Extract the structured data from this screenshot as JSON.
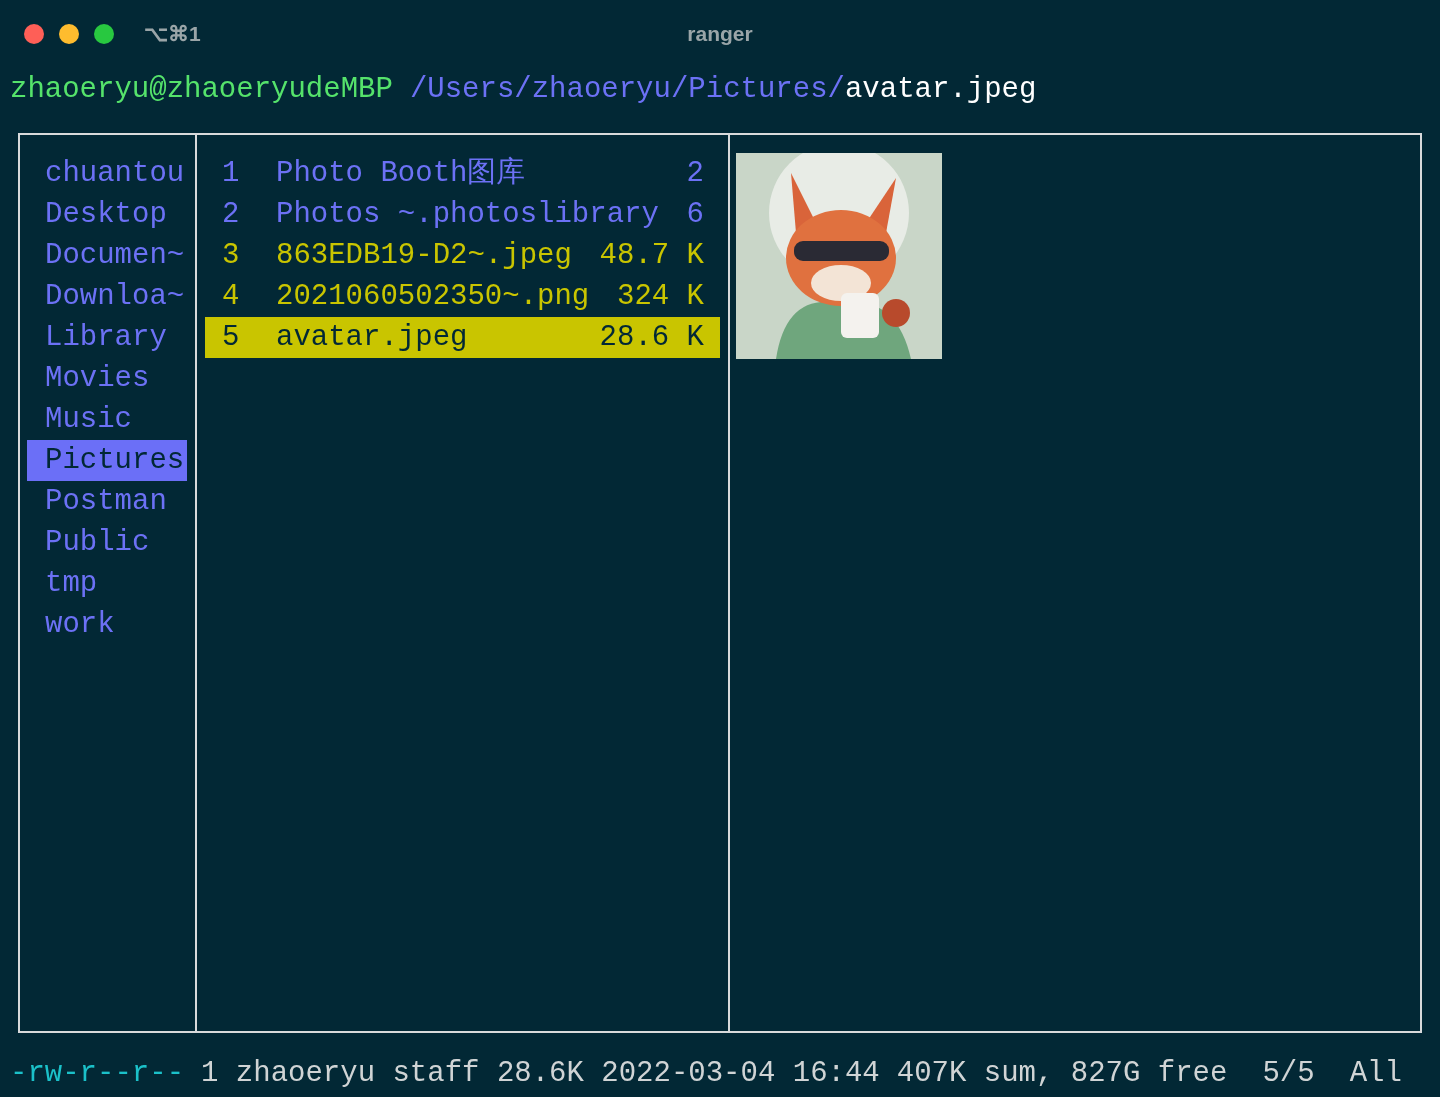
{
  "window": {
    "shortcut": "⌥⌘1",
    "title": "ranger"
  },
  "prompt": {
    "user_host": "zhaoeryu@zhaoeryudeMBP",
    "directory": "/Users/zhaoeryu/Pictures/",
    "file": "avatar.jpeg"
  },
  "parent_column": [
    {
      "name": "chuantou",
      "selected": false
    },
    {
      "name": "Desktop",
      "selected": false
    },
    {
      "name": "Documen~",
      "selected": false
    },
    {
      "name": "Downloa~",
      "selected": false
    },
    {
      "name": "Library",
      "selected": false
    },
    {
      "name": "Movies",
      "selected": false
    },
    {
      "name": "Music",
      "selected": false
    },
    {
      "name": "Pictures",
      "selected": true
    },
    {
      "name": "Postman",
      "selected": false
    },
    {
      "name": "Public",
      "selected": false
    },
    {
      "name": "tmp",
      "selected": false
    },
    {
      "name": "work",
      "selected": false
    }
  ],
  "current_column": [
    {
      "index": "1",
      "name": "Photo Booth图库",
      "size": "2",
      "kind": "dir",
      "selected": false
    },
    {
      "index": "2",
      "name": "Photos ~.photoslibrary",
      "size": "6",
      "kind": "dir",
      "selected": false
    },
    {
      "index": "3",
      "name": "863EDB19-D2~.jpeg",
      "size": "48.7 K",
      "kind": "file",
      "selected": false
    },
    {
      "index": "4",
      "name": "2021060502350~.png",
      "size": "324 K",
      "kind": "file",
      "selected": false
    },
    {
      "index": "5",
      "name": "avatar.jpeg",
      "size": "28.6 K",
      "kind": "file",
      "selected": true
    }
  ],
  "status_bar": {
    "permissions": "-rw-r--r--",
    "info": "1 zhaoeryu staff 28.6K 2022-03-04 16:44",
    "disk": "407K sum, 827G free",
    "position": "5/5",
    "scroll": "All"
  }
}
